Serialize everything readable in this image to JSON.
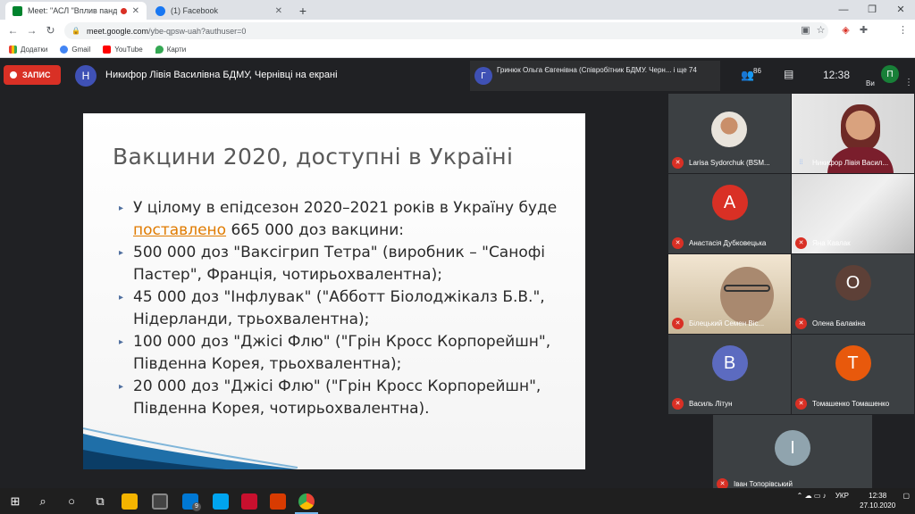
{
  "browser": {
    "tabs": [
      {
        "title": "Meet: \"АСЛ \"Вплив пандемії",
        "active": true
      },
      {
        "title": "(1) Facebook",
        "active": false
      }
    ],
    "new_tab_symbol": "+",
    "url_host": "meet.google.com",
    "url_path": "/ybe-qpsw-uah?authuser=0",
    "profile_initial": "П",
    "bookmarks": [
      "Додатки",
      "Gmail",
      "YouTube",
      "Карти"
    ]
  },
  "meet": {
    "record_label": "ЗАПИС",
    "presenter_initial": "Н",
    "presenter_text": "Никифор Лівія Василівна БДМУ, Чернівці на екрані",
    "others_initial": "Г",
    "others_text": "Гринюк Ольга Євгенівна (Співробітник БДМУ. Черн... і ще 74",
    "participants_count": "86",
    "clock": "12:38",
    "user_initial": "П",
    "user_label": "Ви"
  },
  "slide": {
    "title": "Вакцини 2020, доступні в Україні",
    "bullets": [
      {
        "pre": "У цілому в епідсезон 2020–2021 років в Україну буде ",
        "highlight": "поставлено",
        "post": " 665 000 доз вакцини:"
      },
      {
        "pre": "500 000 доз \"Ваксігрип Тетра\" (виробник – \"Санофі Пастер\", Франція, чотирьохвалентна);",
        "highlight": "",
        "post": ""
      },
      {
        "pre": "45 000 доз \"Інфлувак\" (\"Абботт Біолоджікалз Б.В.\", Нідерланди, трьохвалентна);",
        "highlight": "",
        "post": ""
      },
      {
        "pre": "100 000 доз \"Джісі Флю\" (\"Грін Кросс Корпорейшн\", Південна Корея, трьохвалентна);",
        "highlight": "",
        "post": ""
      },
      {
        "pre": "20 000 доз \"Джісі Флю\" (\"Грін Кросс Корпорейшн\", Південна Корея, чотирьохвалентна).",
        "highlight": "",
        "post": ""
      }
    ]
  },
  "participants": [
    {
      "name": "Larisa Sydorchuk (BSM...",
      "initial": "",
      "color": "",
      "mic": "muted",
      "kind": "photo-doctor"
    },
    {
      "name": "Никифор Лівія Васил...",
      "initial": "",
      "color": "",
      "mic": "on",
      "kind": "photo-woman"
    },
    {
      "name": "Анастасія Дубковецька",
      "initial": "А",
      "color": "#d93025",
      "mic": "muted",
      "kind": "avatar"
    },
    {
      "name": "Яна Кавлак",
      "initial": "",
      "color": "",
      "mic": "muted",
      "kind": "photo-room"
    },
    {
      "name": "Білецький Семен Віс...",
      "initial": "",
      "color": "",
      "mic": "muted",
      "kind": "photo-man"
    },
    {
      "name": "Олена Балакіна",
      "initial": "О",
      "color": "#5d4037",
      "mic": "muted",
      "kind": "avatar"
    },
    {
      "name": "Василь Літун",
      "initial": "В",
      "color": "#5c6bc0",
      "mic": "muted",
      "kind": "avatar"
    },
    {
      "name": "Томашенко Томашенко",
      "initial": "Т",
      "color": "#e8590c",
      "mic": "muted",
      "kind": "avatar"
    },
    {
      "name": "Іван Топорівський",
      "initial": "І",
      "color": "#90a4ae",
      "mic": "muted",
      "kind": "avatar"
    }
  ],
  "taskbar": {
    "tray_lang": "УКР",
    "tray_time": "12:38",
    "tray_date": "27.10.2020",
    "mail_badge": "9"
  }
}
